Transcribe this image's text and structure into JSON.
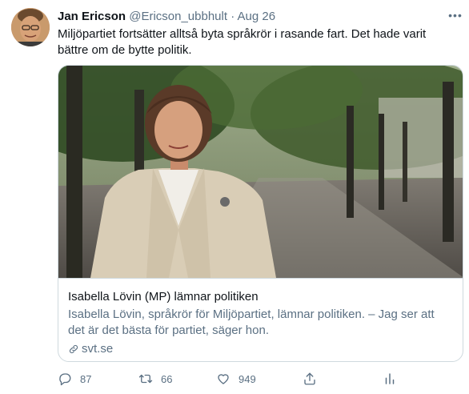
{
  "author": {
    "name": "Jan Ericson",
    "handle": "@Ericson_ubbhult",
    "separator": "·",
    "date": "Aug 26",
    "avatar_icon": "user-avatar"
  },
  "tweet_text": "Miljöpartiet fortsätter alltså byta språkrör i rasande fart. Det hade varit bättre om de bytte politik.",
  "more_icon": "more-horizontal-icon",
  "more_glyph": "•••",
  "card": {
    "image_icon": "photo-woman-in-tree-lined-street",
    "title": "Isabella Lövin (MP) lämnar politiken",
    "description": "Isabella Lövin, språkrör för Miljöpartiet, lämnar politiken. – Jag ser att det är det bästa för partiet, säger hon.",
    "domain": "svt.se",
    "link_icon": "link-icon"
  },
  "actions": {
    "reply_count": "87",
    "retweet_count": "66",
    "like_count": "949",
    "share_icon": "share-icon",
    "analytics_icon": "analytics-icon"
  },
  "colors": {
    "text": "#0f1419",
    "secondary": "#5b7083",
    "border": "#cfd9de"
  }
}
